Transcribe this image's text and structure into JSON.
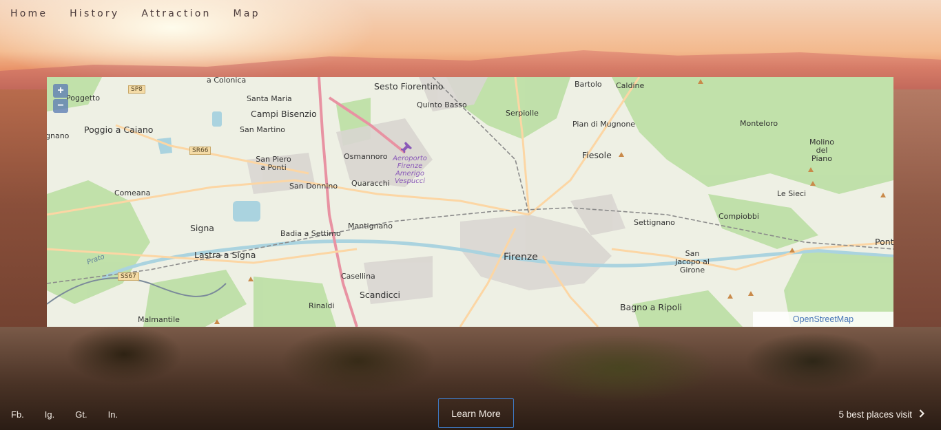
{
  "nav": {
    "items": [
      "Home",
      "History",
      "Attraction",
      "Map"
    ]
  },
  "map": {
    "zoom_in": "+",
    "zoom_out": "−",
    "attribution": "OpenStreetMap",
    "labels": {
      "colonica": "a Colonica",
      "sp8": "SP8",
      "poggetto": "Poggetto",
      "sesto": "Sesto Fiorentino",
      "bartolo": "Bartolo",
      "caldine": "Caldine",
      "santa_maria": "Santa Maria",
      "quinto_basso": "Quinto Basso",
      "campi": "Campi Bisenzio",
      "serpiolle": "Serpiolle",
      "poggio": "Poggio a Caiano",
      "gnano": "gnano",
      "san_martino": "San Martino",
      "pian_mugnone": "Pian di Mugnone",
      "monteloro": "Monteloro",
      "molino": "Molino del Piano",
      "sr66": "SR66",
      "osmannoro": "Osmannoro",
      "aeroporto": "Aeroporto Firenze Amerigo Vespucci",
      "fiesole": "Fiesole",
      "san_piero": "San Piero a Ponti",
      "san_donnino": "San Donnino",
      "quaracchi": "Quaracchi",
      "comeana": "Comeana",
      "le_sieci": "Le Sieci",
      "compiobbi": "Compiobbi",
      "mantignano": "Mantignano",
      "settignano": "Settignano",
      "signa": "Signa",
      "badia": "Badia a Settimo",
      "pontas": "Pontas",
      "lastra": "Lastra a Signa",
      "firenze": "Firenze",
      "san_jacopo": "San Jacopo al Girone",
      "ss67": "SS67",
      "casellina": "Casellina",
      "scandicci": "Scandicci",
      "rinaldi": "Rinaldi",
      "bagno": "Bagno a Ripoli",
      "malmantile": "Malmantile",
      "prato_river": "Prato"
    }
  },
  "footer": {
    "social": [
      "Fb.",
      "Ig.",
      "Gt.",
      "In."
    ],
    "learn_more": "Learn More",
    "next_label": "5 best places visit",
    "next_icon": "chevron-right-icon"
  }
}
